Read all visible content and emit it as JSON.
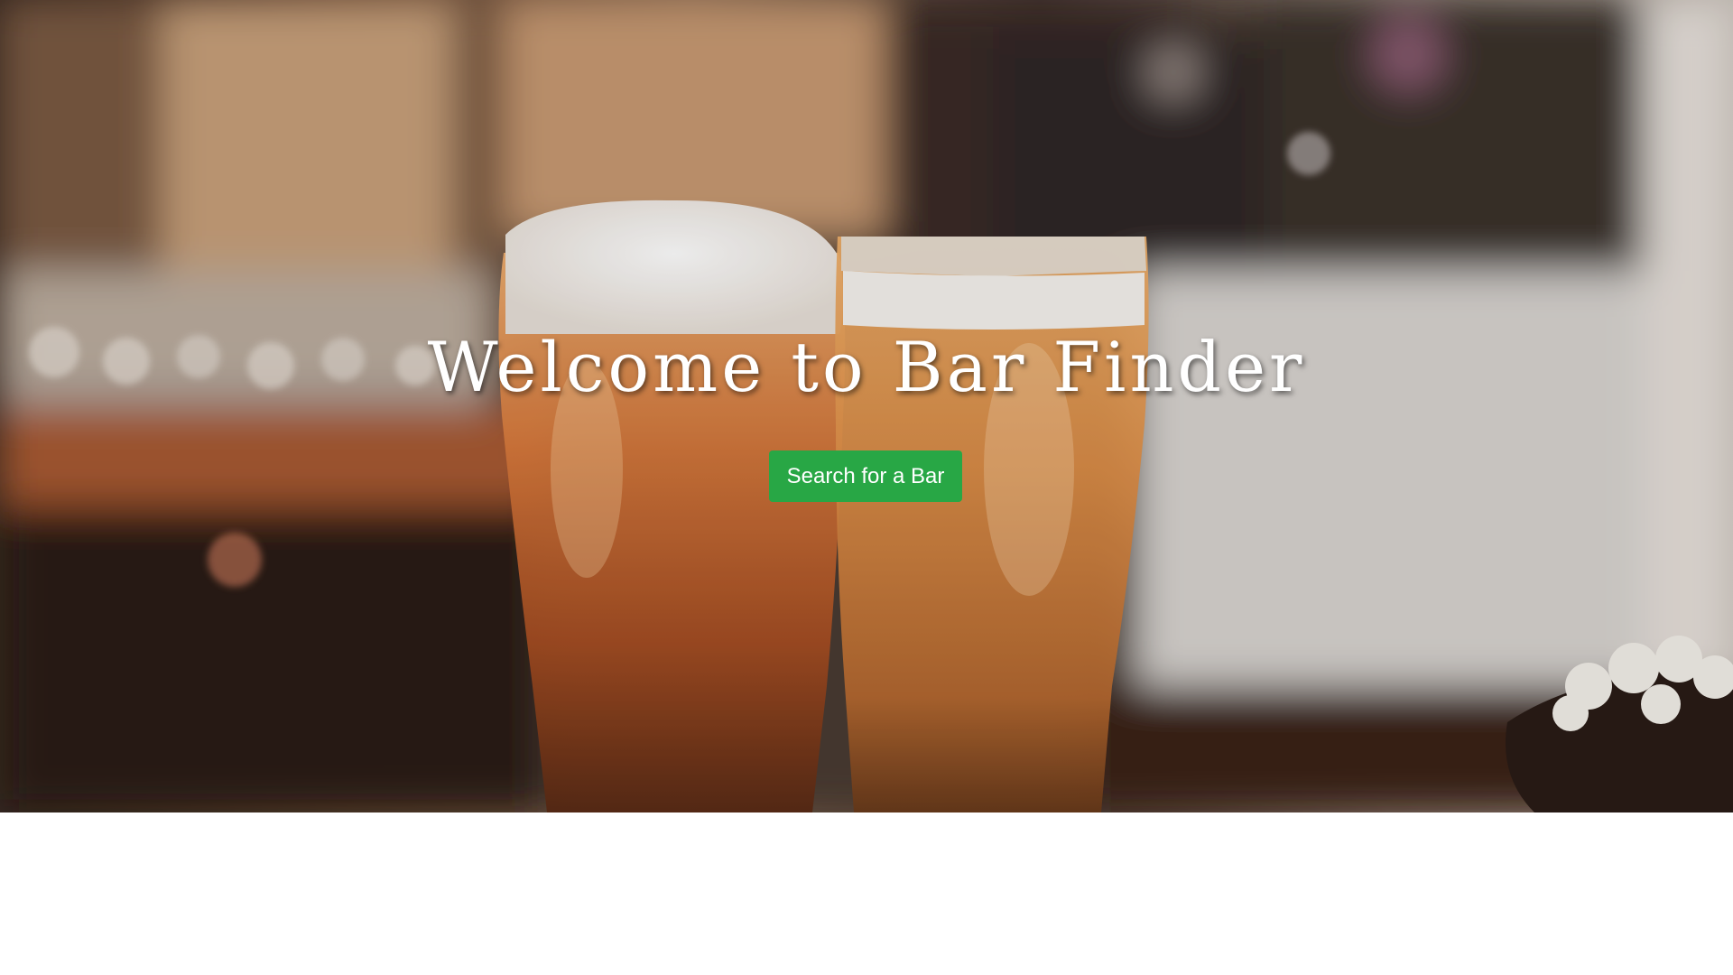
{
  "hero": {
    "title": "Welcome to Bar Finder",
    "search_button_label": "Search for a Bar",
    "image": "beer-glasses-photo"
  },
  "colors": {
    "button_bg": "#28a745",
    "button_text": "#ffffff",
    "title_text": "#ffffff",
    "page_bg": "#ffffff"
  }
}
